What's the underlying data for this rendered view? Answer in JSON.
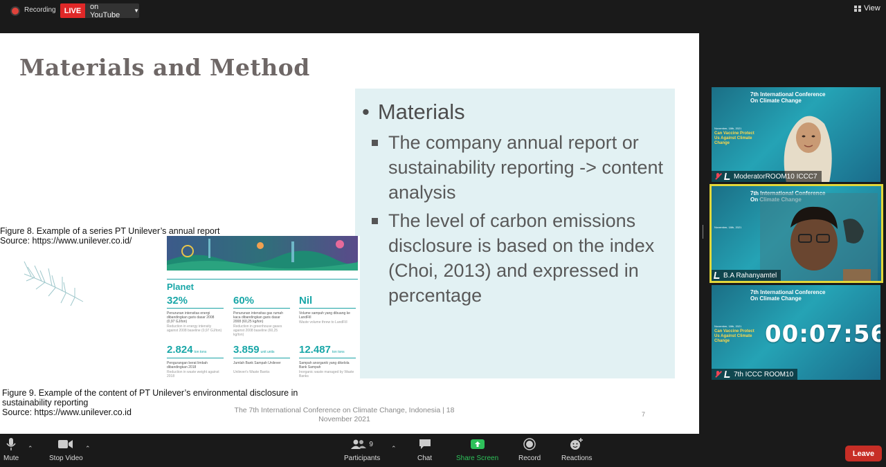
{
  "topbar": {
    "recording_label": "Recording",
    "live_label": "LIVE",
    "youtube_label": "on YouTube",
    "view_label": "View"
  },
  "slide": {
    "title": "Materials and Method",
    "bullet_main": "Materials",
    "bullets": [
      "The company annual report or sustainability reporting -> content analysis",
      "The level of carbon emissions disclosure is based on the index (Choi, 2013) and expressed in percentage"
    ],
    "figure8_caption_line1": "Figure 8. Example of a series PT Unilever’s annual report",
    "figure8_caption_line2": "Source: https://www.unilever.co.id/",
    "figure9_caption_line1": "Figure 9. Example of  the content of PT Unilever’s environmental disclosure in",
    "figure9_caption_line2": "sustainability reporting",
    "figure9_caption_line3": "Source: https://www.unilever.co.id",
    "footer": "The 7th International Conference on Climate Change, Indonesia | 18 November 2021",
    "page_number": "7",
    "report": {
      "heading": "Planet",
      "stats": [
        {
          "value": "32%",
          "text": "Penurunan intensitas energi dibandingkan garis dasar 2008 (0,97 GJ/ton)",
          "subtext": "Reduction in energy intensity against 2008 baseline (0,97 GJ/ton)"
        },
        {
          "value": "60%",
          "text": "Penurunan intensitas gas rumah kaca dibandingkan garis dasar 2008 (60,25 kg/ton)",
          "subtext": "Reduction in greenhouse gases against 2008 baseline (60,25 kg/ton)"
        },
        {
          "value": "Nil",
          "text": "Volume sampah yang dibuang ke LandFill",
          "subtext": "Waste volume threw to LandFill"
        },
        {
          "value": "2.824",
          "unit": "ton tons",
          "text": "Pengurangan berat limbah dibandingkan 2018",
          "subtext": "Reduction in waste weight against 2018"
        },
        {
          "value": "3.859",
          "unit": "unit units",
          "text": "Jumlah Bank Sampah Unilever",
          "subtext": "Unilever's Waste Banks"
        },
        {
          "value": "12.487",
          "unit": "ton tons",
          "text": "Sampah anorganik yang dikelola Bank Sampah",
          "subtext": "Inorganic waste managed by Waste Banks"
        }
      ]
    }
  },
  "participants": [
    {
      "name": "ModeratorROOM10 ICCC7",
      "muted": true
    },
    {
      "name": "B.A Rahanyamtel",
      "muted": false
    },
    {
      "name": "7th ICCC ROOM10",
      "muted": true
    }
  ],
  "conference_banner": {
    "title_line1": "7th International Conference",
    "title_line2": "On Climate Change",
    "date": "November, 18th, 2021",
    "tagline": "Can Vaccine Protect Us Against Climate Change"
  },
  "timer": "00:07:56",
  "toolbar": {
    "mute": "Mute",
    "stop_video": "Stop Video",
    "participants": "Participants",
    "participants_count": "9",
    "chat": "Chat",
    "share_screen": "Share Screen",
    "record": "Record",
    "reactions": "Reactions",
    "leave": "Leave"
  },
  "colors": {
    "live_red": "#e02828",
    "share_green": "#2ec15a",
    "leave_red": "#c72e26",
    "active_speaker_border": "#e2d83a",
    "report_teal": "#1aa7a8",
    "panel_bg": "#e2f1f3"
  }
}
